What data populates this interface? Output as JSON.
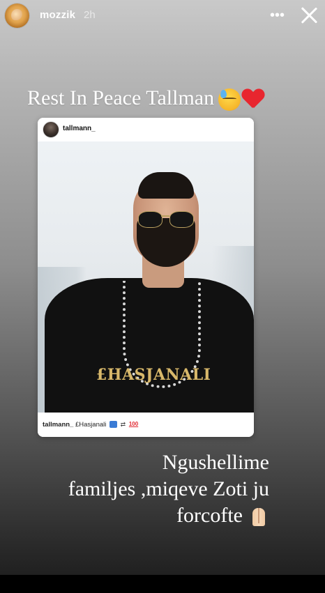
{
  "header": {
    "username": "mozzik",
    "time": "2h",
    "more_icon": "more-icon",
    "close_icon": "close-icon"
  },
  "caption_top": {
    "text": "Rest In Peace  Tallman",
    "emojis": [
      "downcast-face-with-sweat",
      "red-heart"
    ]
  },
  "post": {
    "username": "tallmann_",
    "shirt_text": "£HASJANALI",
    "caption_user": "tallmann_",
    "caption_text": "£Hasjanali",
    "caption_emojis": [
      "up-button",
      "arrows",
      "hundred-points"
    ]
  },
  "caption_bottom": {
    "line1": "Ngushellime",
    "line2": "familjes ,miqeve Zoti ju",
    "line3": "forcofte",
    "emoji": "folded-hands"
  }
}
